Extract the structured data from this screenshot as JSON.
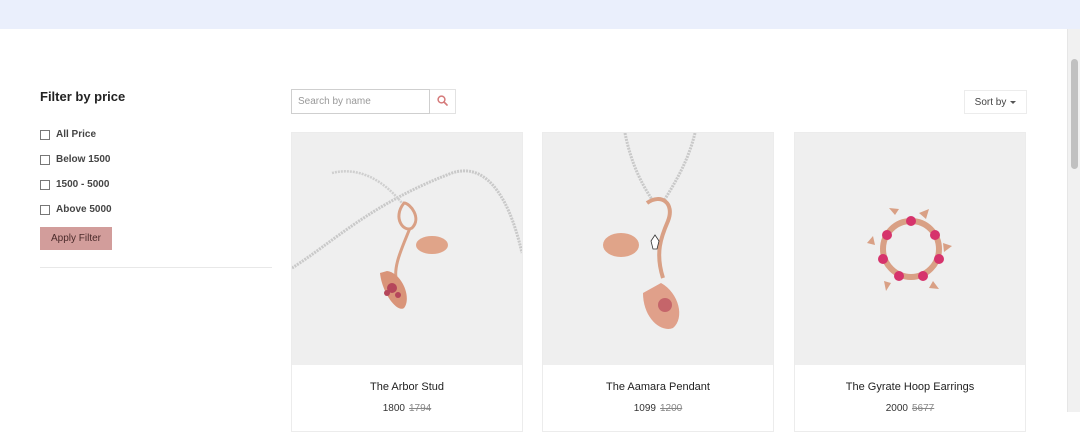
{
  "filter": {
    "title": "Filter by price",
    "options": [
      "All Price",
      "Below 1500",
      "1500 - 5000",
      "Above 5000"
    ],
    "apply_label": "Apply Filter"
  },
  "search": {
    "placeholder": "Search by name",
    "value": ""
  },
  "sort": {
    "label": "Sort by"
  },
  "products": [
    {
      "name": "The Arbor Stud",
      "price": "1800",
      "old_price": "1794"
    },
    {
      "name": "The Aamara Pendant",
      "price": "1099",
      "old_price": "1200"
    },
    {
      "name": "The Gyrate Hoop Earrings",
      "price": "2000",
      "old_price": "5677"
    }
  ],
  "colors": {
    "accent": "#d29d9b",
    "topband": "#eaeffc",
    "search_icon": "#d57a7a"
  },
  "icons": [
    "search-icon",
    "chevron-down-icon",
    "hand-cursor-icon"
  ]
}
